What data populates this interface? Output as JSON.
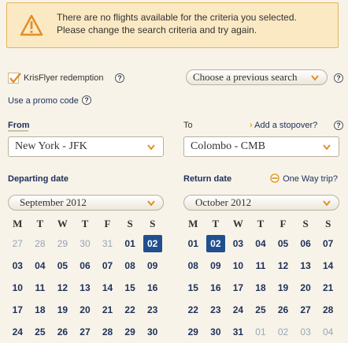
{
  "alert": {
    "line1": "There are no flights available for the criteria you selected.",
    "line2": "Please change the search criteria and try again."
  },
  "options": {
    "krisflyer_label": "KrisFlyer redemption",
    "promo_label": "Use a promo code",
    "previous_search_label": "Choose a previous search"
  },
  "route": {
    "from_label": "From",
    "to_label": "To",
    "stopover_label": "Add a stopover?",
    "from_value": "New York - JFK",
    "to_value": "Colombo - CMB"
  },
  "dates": {
    "departing_label": "Departing date",
    "return_label": "Return date",
    "one_way_label": "One Way trip?",
    "departing_month": "September 2012",
    "return_month": "October 2012",
    "weekdays": [
      "M",
      "T",
      "W",
      "T",
      "F",
      "S",
      "S"
    ]
  },
  "departing_calendar": [
    [
      {
        "d": "27",
        "s": "dim"
      },
      {
        "d": "28",
        "s": "dim"
      },
      {
        "d": "29",
        "s": "dim"
      },
      {
        "d": "30",
        "s": "dim"
      },
      {
        "d": "31",
        "s": "dim"
      },
      {
        "d": "01",
        "s": ""
      },
      {
        "d": "02",
        "s": "sel"
      }
    ],
    [
      {
        "d": "03",
        "s": ""
      },
      {
        "d": "04",
        "s": ""
      },
      {
        "d": "05",
        "s": ""
      },
      {
        "d": "06",
        "s": ""
      },
      {
        "d": "07",
        "s": ""
      },
      {
        "d": "08",
        "s": ""
      },
      {
        "d": "09",
        "s": ""
      }
    ],
    [
      {
        "d": "10",
        "s": ""
      },
      {
        "d": "11",
        "s": ""
      },
      {
        "d": "12",
        "s": ""
      },
      {
        "d": "13",
        "s": ""
      },
      {
        "d": "14",
        "s": ""
      },
      {
        "d": "15",
        "s": ""
      },
      {
        "d": "16",
        "s": ""
      }
    ],
    [
      {
        "d": "17",
        "s": ""
      },
      {
        "d": "18",
        "s": ""
      },
      {
        "d": "19",
        "s": ""
      },
      {
        "d": "20",
        "s": ""
      },
      {
        "d": "21",
        "s": ""
      },
      {
        "d": "22",
        "s": ""
      },
      {
        "d": "23",
        "s": ""
      }
    ],
    [
      {
        "d": "24",
        "s": ""
      },
      {
        "d": "25",
        "s": ""
      },
      {
        "d": "26",
        "s": ""
      },
      {
        "d": "27",
        "s": ""
      },
      {
        "d": "28",
        "s": ""
      },
      {
        "d": "29",
        "s": ""
      },
      {
        "d": "30",
        "s": ""
      }
    ]
  ],
  "return_calendar": [
    [
      {
        "d": "01",
        "s": ""
      },
      {
        "d": "02",
        "s": "sel"
      },
      {
        "d": "03",
        "s": ""
      },
      {
        "d": "04",
        "s": ""
      },
      {
        "d": "05",
        "s": ""
      },
      {
        "d": "06",
        "s": ""
      },
      {
        "d": "07",
        "s": ""
      }
    ],
    [
      {
        "d": "08",
        "s": ""
      },
      {
        "d": "09",
        "s": ""
      },
      {
        "d": "10",
        "s": ""
      },
      {
        "d": "11",
        "s": ""
      },
      {
        "d": "12",
        "s": ""
      },
      {
        "d": "13",
        "s": ""
      },
      {
        "d": "14",
        "s": ""
      }
    ],
    [
      {
        "d": "15",
        "s": ""
      },
      {
        "d": "16",
        "s": ""
      },
      {
        "d": "17",
        "s": ""
      },
      {
        "d": "18",
        "s": ""
      },
      {
        "d": "19",
        "s": ""
      },
      {
        "d": "20",
        "s": ""
      },
      {
        "d": "21",
        "s": ""
      }
    ],
    [
      {
        "d": "22",
        "s": ""
      },
      {
        "d": "23",
        "s": ""
      },
      {
        "d": "24",
        "s": ""
      },
      {
        "d": "25",
        "s": ""
      },
      {
        "d": "26",
        "s": ""
      },
      {
        "d": "27",
        "s": ""
      },
      {
        "d": "28",
        "s": ""
      }
    ],
    [
      {
        "d": "29",
        "s": ""
      },
      {
        "d": "30",
        "s": ""
      },
      {
        "d": "31",
        "s": ""
      },
      {
        "d": "01",
        "s": "dim"
      },
      {
        "d": "02",
        "s": "dim"
      },
      {
        "d": "03",
        "s": "dim"
      },
      {
        "d": "04",
        "s": "dim"
      }
    ]
  ],
  "colors": {
    "accent": "#1f4f8f",
    "alert_border": "#e7b25a",
    "alert_bg": "#fbe9c4",
    "arrow": "#e0a030"
  },
  "icons": {
    "alert": "warning-triangle-icon",
    "help": "question-circle-icon",
    "dropdown": "chevron-down-icon",
    "stopover": "chevron-right-icon",
    "checkbox": "checkmark-icon",
    "one_way": "one-way-icon"
  }
}
